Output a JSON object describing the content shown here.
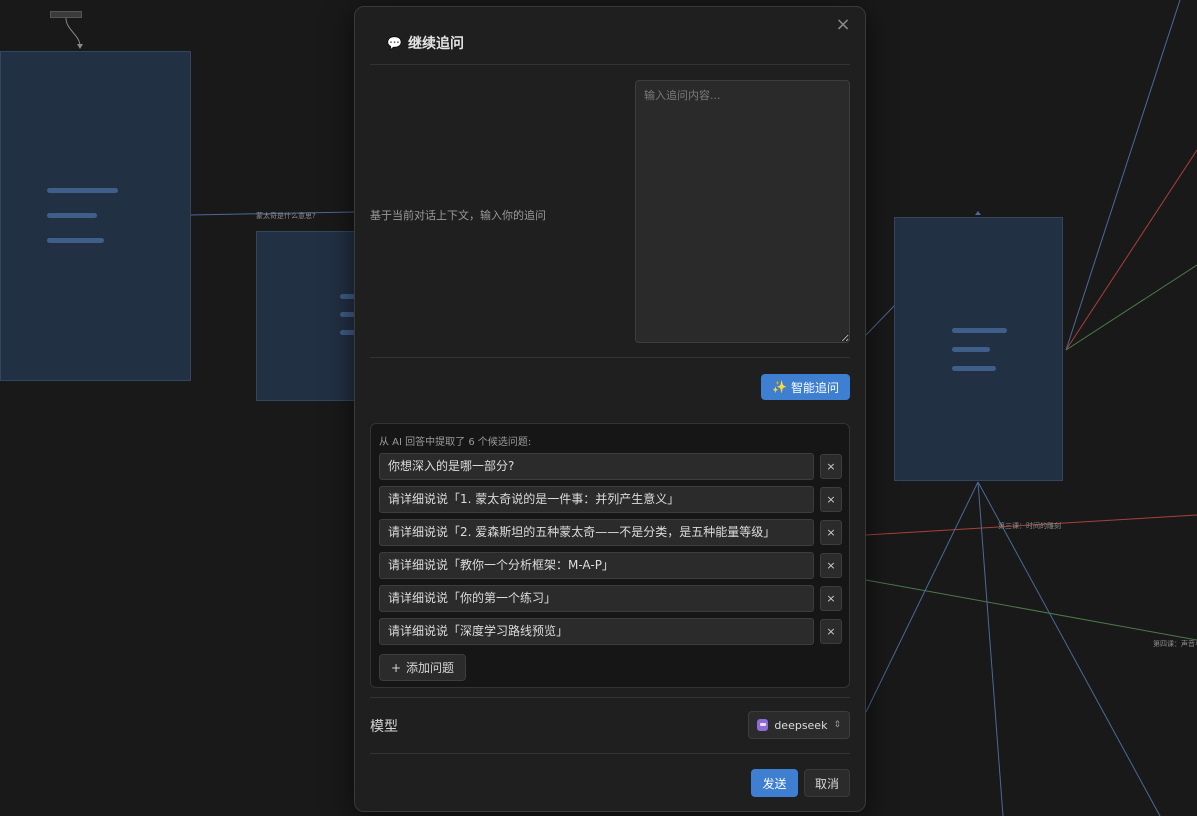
{
  "canvas": {
    "edge_label_1": "蒙太奇是什么意思?",
    "edge_label_2": "第三课：时间的雕刻",
    "edge_label_3": "第四课：声音与"
  },
  "dialog": {
    "title": "继续追问",
    "title_icon": "speech-bubble-icon",
    "close_label": "×",
    "prompt_label": "基于当前对话上下文，输入你的追问",
    "input_placeholder": "输入追问内容...",
    "input_value": "",
    "smart_button_label": "智能追问",
    "smart_button_icon": "sparkles-icon",
    "candidates_caption": "从 AI 回答中提取了 6 个候选问题:",
    "candidates": [
      "你想深入的是哪一部分?",
      "请详细说说「1. 蒙太奇说的是一件事：并列产生意义」",
      "请详细说说「2. 爱森斯坦的五种蒙太奇——不是分类，是五种能量等级」",
      "请详细说说「教你一个分析框架：M-A-P」",
      "请详细说说「你的第一个练习」",
      "请详细说说「深度学习路线预览」"
    ],
    "remove_label": "×",
    "add_label": "添加问题",
    "add_symbol": "+",
    "model_label": "模型",
    "model_value": "deepseek",
    "send_label": "发送",
    "cancel_label": "取消"
  },
  "colors": {
    "accent": "#3f7fd1",
    "background": "#191919",
    "dialog": "#1f1f1f",
    "node": "#223044"
  }
}
